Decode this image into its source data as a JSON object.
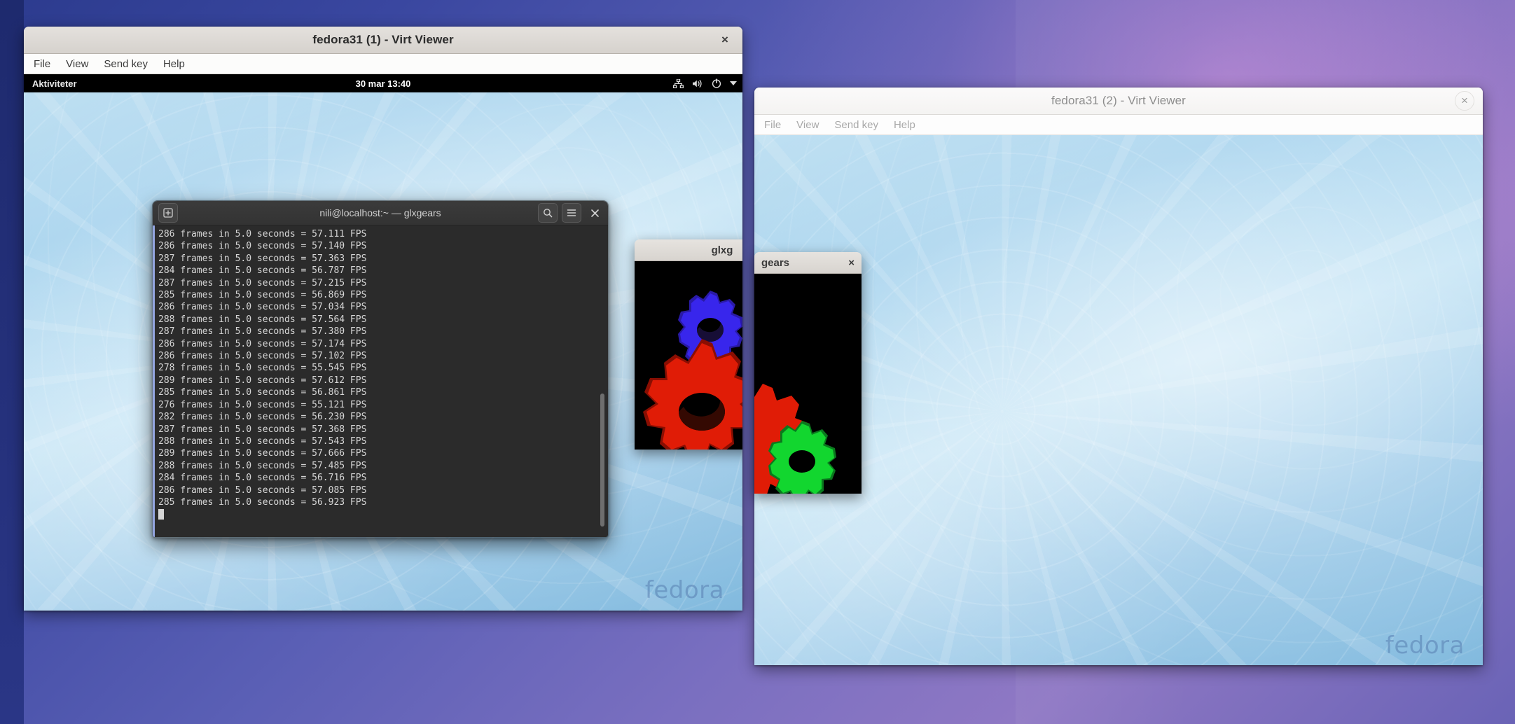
{
  "desktop": {
    "background_colors": [
      "#2c3b8e",
      "#5a5fb5",
      "#8f78c4"
    ]
  },
  "window1": {
    "title": "fedora31 (1) - Virt Viewer",
    "close_label": "×",
    "menu": [
      "File",
      "View",
      "Send key",
      "Help"
    ],
    "guest": {
      "topbar": {
        "activities": "Aktiviteter",
        "clock": "30 mar  13:40",
        "icons": [
          "network-icon",
          "volume-icon",
          "power-icon",
          "chevron-down-icon"
        ]
      },
      "wallpaper_logo": "fedora",
      "terminal": {
        "title": "nili@localhost:~ — glxgears",
        "new_tab_label": "+",
        "search_label": "search-icon",
        "menu_label": "☰",
        "close_label": "×",
        "lines": [
          "286 frames in 5.0 seconds = 57.111 FPS",
          "286 frames in 5.0 seconds = 57.140 FPS",
          "287 frames in 5.0 seconds = 57.363 FPS",
          "284 frames in 5.0 seconds = 56.787 FPS",
          "287 frames in 5.0 seconds = 57.215 FPS",
          "285 frames in 5.0 seconds = 56.869 FPS",
          "286 frames in 5.0 seconds = 57.034 FPS",
          "288 frames in 5.0 seconds = 57.564 FPS",
          "287 frames in 5.0 seconds = 57.380 FPS",
          "286 frames in 5.0 seconds = 57.174 FPS",
          "286 frames in 5.0 seconds = 57.102 FPS",
          "278 frames in 5.0 seconds = 55.545 FPS",
          "289 frames in 5.0 seconds = 57.612 FPS",
          "285 frames in 5.0 seconds = 56.861 FPS",
          "276 frames in 5.0 seconds = 55.121 FPS",
          "282 frames in 5.0 seconds = 56.230 FPS",
          "287 frames in 5.0 seconds = 57.368 FPS",
          "288 frames in 5.0 seconds = 57.543 FPS",
          "289 frames in 5.0 seconds = 57.666 FPS",
          "288 frames in 5.0 seconds = 57.485 FPS",
          "284 frames in 5.0 seconds = 56.716 FPS",
          "286 frames in 5.0 seconds = 57.085 FPS",
          "285 frames in 5.0 seconds = 56.923 FPS"
        ]
      },
      "glxgears_window": {
        "title": "glxg",
        "gear_colors": {
          "blue": "#3322dd",
          "red": "#cc1100",
          "green": "#00bb22"
        }
      }
    }
  },
  "window2": {
    "title": "fedora31 (2) - Virt Viewer",
    "close_label": "×",
    "menu": [
      "File",
      "View",
      "Send key",
      "Help"
    ],
    "guest": {
      "wallpaper_logo": "fedora",
      "glxgears_window": {
        "title": "gears",
        "close_label": "×",
        "gear_colors": {
          "red": "#cc1100",
          "green": "#00bb22"
        }
      }
    }
  }
}
